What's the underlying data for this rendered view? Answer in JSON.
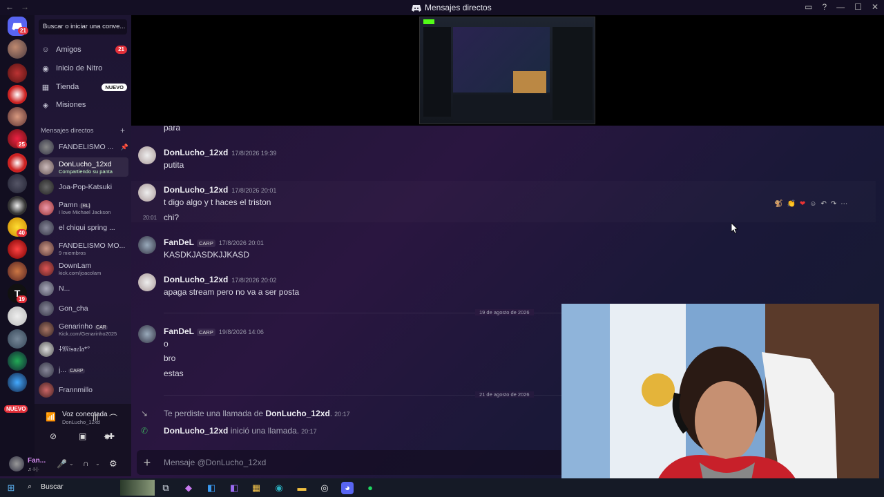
{
  "window": {
    "title": "Mensajes directos",
    "back_icon": "arrow-left-icon",
    "fwd_icon": "arrow-right-icon",
    "inbox_icon": "inbox-icon",
    "help_icon": "help-icon",
    "min": "—",
    "max": "☐",
    "close": "✕"
  },
  "rail": {
    "home_badge": "21",
    "servers": [
      {
        "badge": ""
      },
      {
        "badge": ""
      },
      {
        "badge": ""
      },
      {
        "badge": ""
      },
      {
        "badge": "25"
      },
      {
        "badge": ""
      },
      {
        "badge": ""
      },
      {
        "badge": ""
      },
      {
        "badge": "40"
      },
      {
        "badge": ""
      },
      {
        "badge": ""
      },
      {
        "badge": "19"
      },
      {
        "badge": ""
      },
      {
        "badge": ""
      },
      {
        "badge": ""
      },
      {
        "badge": ""
      }
    ],
    "new_label": "NUEVO"
  },
  "sidebar": {
    "search_placeholder": "Buscar o iniciar una conve...",
    "nav": [
      {
        "label": "Amigos",
        "icon": "friends-icon",
        "count": "21"
      },
      {
        "label": "Inicio de Nitro",
        "icon": "nitro-icon"
      },
      {
        "label": "Tienda",
        "icon": "shop-icon",
        "tag": "NUEVO"
      },
      {
        "label": "Misiones",
        "icon": "quests-icon"
      }
    ],
    "dm_header": "Mensajes directos",
    "dms": [
      {
        "name": "FANDELISMO ...",
        "sub": "",
        "tag": ""
      },
      {
        "name": "DonLucho_12xd",
        "sub": "Compartiendo su panta",
        "tag": ""
      },
      {
        "name": "Joa-Pop-Katsuki",
        "sub": "",
        "tag": ""
      },
      {
        "name": "Pamn",
        "sub": "I love Michael Jackson",
        "tag": "[RL]"
      },
      {
        "name": "el chiqui spring ...",
        "sub": "",
        "tag": ""
      },
      {
        "name": "FANDELISMO MO...",
        "sub": "9 miembros",
        "tag": ""
      },
      {
        "name": "DownLam",
        "sub": "kick.com/joacolam",
        "tag": ""
      },
      {
        "name": "N...",
        "sub": "",
        "tag": ""
      },
      {
        "name": "Gon_cha",
        "sub": "",
        "tag": ""
      },
      {
        "name": "Genarinho",
        "sub": "Kick.com/Genarinho2025",
        "tag": "CAR"
      },
      {
        "name": "⸸𝔐𝔦𝔰𝔞𝔢𝔩𝔞*°",
        "sub": "",
        "tag": ""
      },
      {
        "name": "j...",
        "sub": "",
        "tag": "CARP"
      },
      {
        "name": "Frannmillo",
        "sub": "",
        "tag": ""
      }
    ]
  },
  "voice": {
    "title": "Voz conectada",
    "sub": "DonLucho_12xd",
    "user": "Fan...",
    "status": "♫·I·|·"
  },
  "messages": {
    "top_fragment": "para",
    "items": [
      {
        "author": "DonLucho_12xd",
        "time": "17/8/2026 19:39",
        "role": "",
        "lines": [
          "putita"
        ]
      },
      {
        "author": "DonLucho_12xd",
        "time": "17/8/2026 20:01",
        "role": "",
        "lines": [
          "t digo algo y t haces el triston"
        ]
      },
      {
        "author": "",
        "time": "",
        "role": "",
        "side_time": "20:01",
        "lines": [
          "chi?"
        ]
      },
      {
        "author": "FanDeL",
        "time": "17/8/2026 20:01",
        "role": "CARP",
        "lines": [
          "KASDKJASDKJJKASD"
        ]
      },
      {
        "author": "DonLucho_12xd",
        "time": "17/8/2026 20:02",
        "role": "",
        "lines": [
          "apaga stream pero no va a ser posta"
        ]
      },
      {
        "author": "FanDeL",
        "time": "19/8/2026 14:06",
        "role": "CARP",
        "lines": [
          "o",
          "bro",
          "estas"
        ]
      }
    ],
    "divider1": "19 de agosto de 2026",
    "divider2": "21 de agosto de 2026",
    "missed": {
      "prefix": "Te perdiste una llamada de ",
      "who": "DonLucho_12xd",
      "time": "20:17"
    },
    "started": {
      "who": "DonLucho_12xd",
      "text": " inició una llamada.",
      "time": "20:17"
    }
  },
  "composer": {
    "placeholder": "Mensaje @DonLucho_12xd"
  },
  "taskbar": {
    "search": "Buscar"
  }
}
